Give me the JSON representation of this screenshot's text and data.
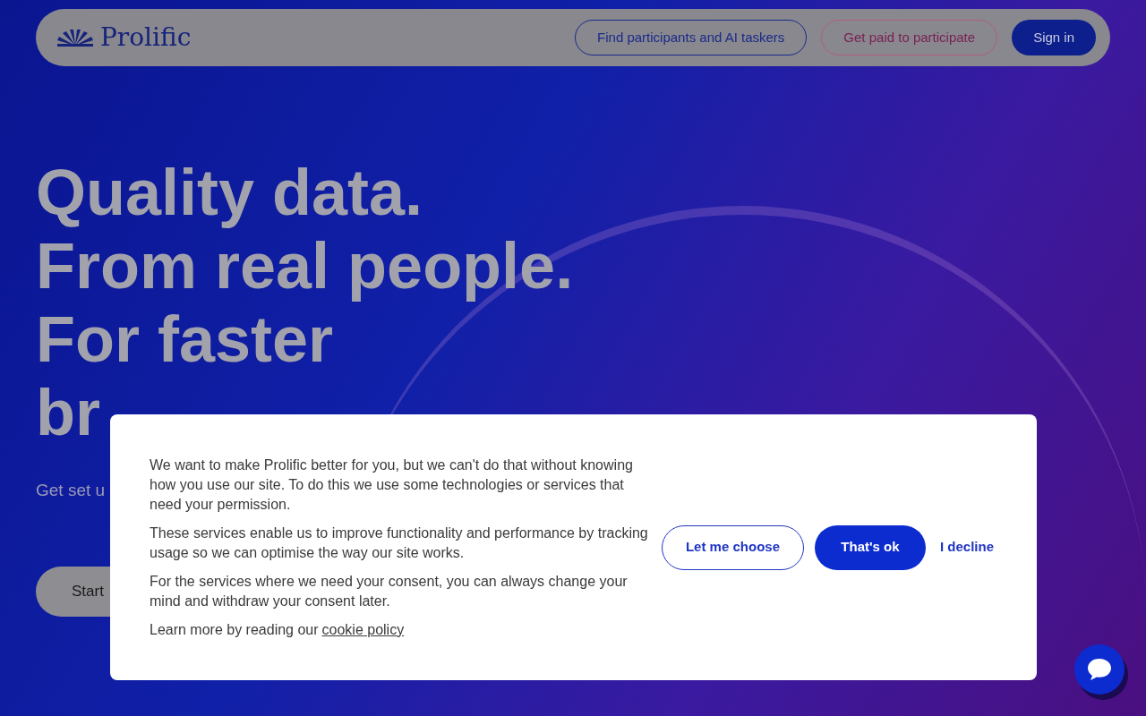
{
  "navbar": {
    "logo": "Prolific",
    "buttons": [
      {
        "label": "Find participants and AI taskers",
        "kind": "outline"
      },
      {
        "label": "Get paid to participate",
        "kind": "pink"
      },
      {
        "label": "Sign in",
        "kind": "solid"
      }
    ]
  },
  "hero": {
    "headline": [
      "Quality data.",
      "From real people.",
      "For faster",
      "br"
    ],
    "subtitle": "Get set u",
    "button": "Start"
  },
  "cookie_dialog": {
    "paragraphs": [
      "We want to make Prolific better for you, but we can't do that without knowing how you use our site. To do this we use some technologies or services that need your permission.",
      "These services enable us to improve functionality and performance by tracking usage so we can optimise the way our site works.",
      "For the services where we need your consent, you can always change your mind and withdraw your consent later."
    ],
    "learn_more": "Learn more by reading our",
    "link": "cookie policy",
    "buttons": [
      {
        "label": "Let me choose",
        "kind": "outline"
      },
      {
        "label": "That's ok",
        "kind": "solid"
      },
      {
        "label": "I decline",
        "kind": "text"
      }
    ]
  }
}
